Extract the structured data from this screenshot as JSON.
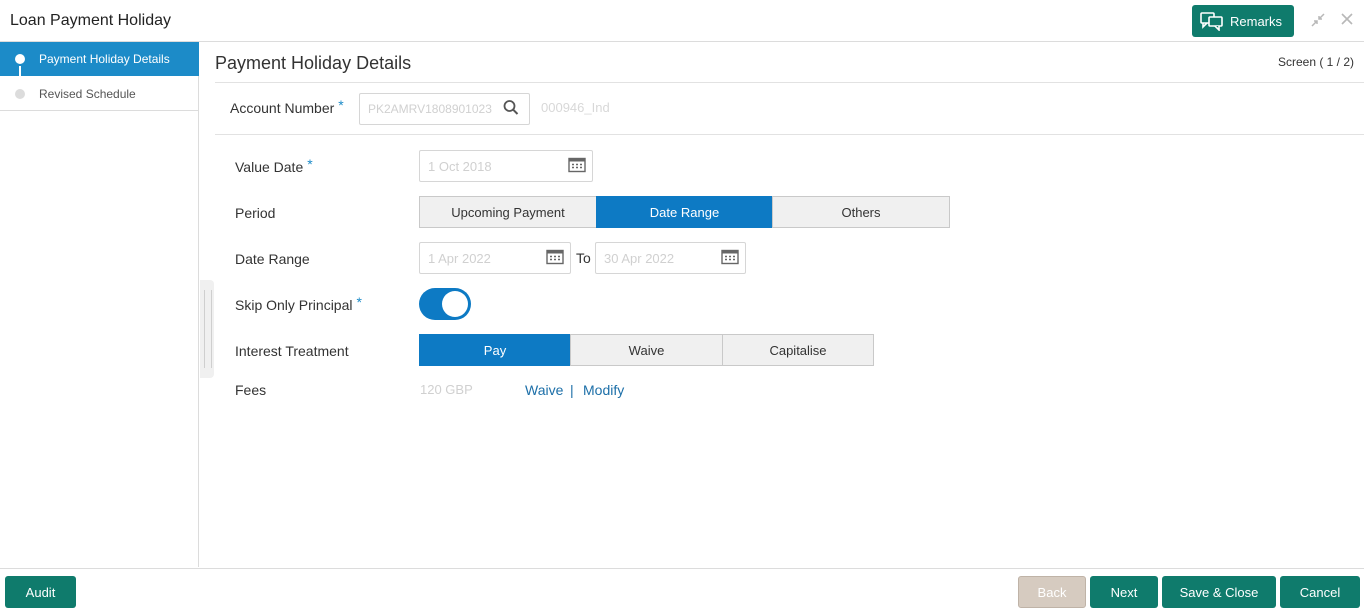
{
  "header": {
    "title": "Loan Payment Holiday",
    "remarks_label": "Remarks",
    "minimize_icon": "shrink-icon",
    "close_icon": "close-icon"
  },
  "sidebar": {
    "items": [
      {
        "label": "Payment Holiday Details",
        "active": true
      },
      {
        "label": "Revised Schedule",
        "active": false
      }
    ]
  },
  "main": {
    "title": "Payment Holiday Details",
    "screen_indicator": "Screen ( 1 / 2)",
    "account_number": {
      "label": "Account Number",
      "value": "PK2AMRV1808901023",
      "customer_name": "000946_Ind"
    },
    "value_date": {
      "label": "Value Date",
      "value": "1 Oct 2018"
    },
    "period": {
      "label": "Period",
      "options": [
        "Upcoming Payment",
        "Date Range",
        "Others"
      ],
      "selected": "Date Range"
    },
    "date_range": {
      "label": "Date Range",
      "from": "1 Apr 2022",
      "to_label": "To",
      "to": "30 Apr 2022"
    },
    "skip_only_principal": {
      "label": "Skip Only Principal",
      "value": true
    },
    "interest_treatment": {
      "label": "Interest Treatment",
      "options": [
        "Pay",
        "Waive",
        "Capitalise"
      ],
      "selected": "Pay"
    },
    "fees": {
      "label": "Fees",
      "value": "120 GBP",
      "waive_label": "Waive",
      "separator": "|",
      "modify_label": "Modify"
    }
  },
  "footer": {
    "audit": "Audit",
    "back": "Back",
    "next": "Next",
    "save_close": "Save & Close",
    "cancel": "Cancel"
  },
  "colors": {
    "accent": "#0f7b6c",
    "selected": "#0d7ac4",
    "sidebar_active": "#1c8bc8"
  }
}
